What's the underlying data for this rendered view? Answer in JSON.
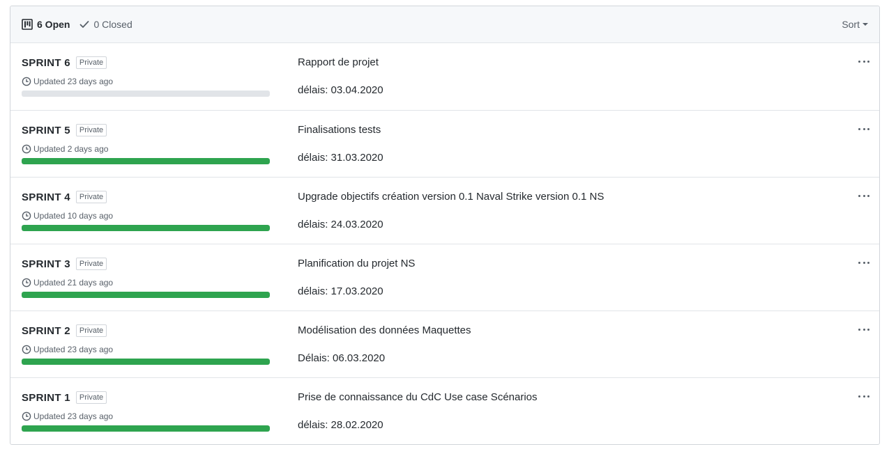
{
  "header": {
    "open_label": "6 Open",
    "closed_label": "0 Closed",
    "sort_label": "Sort"
  },
  "projects": [
    {
      "name": "SPRINT 6",
      "badge": "Private",
      "updated": "Updated 23 days ago",
      "progress": 0,
      "description": "Rapport de projet",
      "deadline": "délais: 03.04.2020"
    },
    {
      "name": "SPRINT 5",
      "badge": "Private",
      "updated": "Updated 2 days ago",
      "progress": 1,
      "description": "Finalisations tests",
      "deadline": "délais: 31.03.2020"
    },
    {
      "name": "SPRINT 4",
      "badge": "Private",
      "updated": "Updated 10 days ago",
      "progress": 1,
      "description": "Upgrade objectifs création version 0.1 Naval Strike version 0.1 NS",
      "deadline": "délais: 24.03.2020"
    },
    {
      "name": "SPRINT 3",
      "badge": "Private",
      "updated": "Updated 21 days ago",
      "progress": 1,
      "description": "Planification du projet NS",
      "deadline": "délais: 17.03.2020"
    },
    {
      "name": "SPRINT 2",
      "badge": "Private",
      "updated": "Updated 23 days ago",
      "progress": 1,
      "description": "Modélisation des données Maquettes",
      "deadline": "Délais: 06.03.2020"
    },
    {
      "name": "SPRINT 1",
      "badge": "Private",
      "updated": "Updated 23 days ago",
      "progress": 1,
      "description": "Prise de connaissance du CdC Use case Scénarios",
      "deadline": "délais: 28.02.2020"
    }
  ],
  "colors": {
    "progress_fill": "#2ea44f",
    "progress_track": "#e1e4e8"
  },
  "icons": {
    "open": "project-board-icon",
    "closed": "check-icon",
    "updated": "clock-icon",
    "menu": "kebab-horizontal-icon"
  }
}
